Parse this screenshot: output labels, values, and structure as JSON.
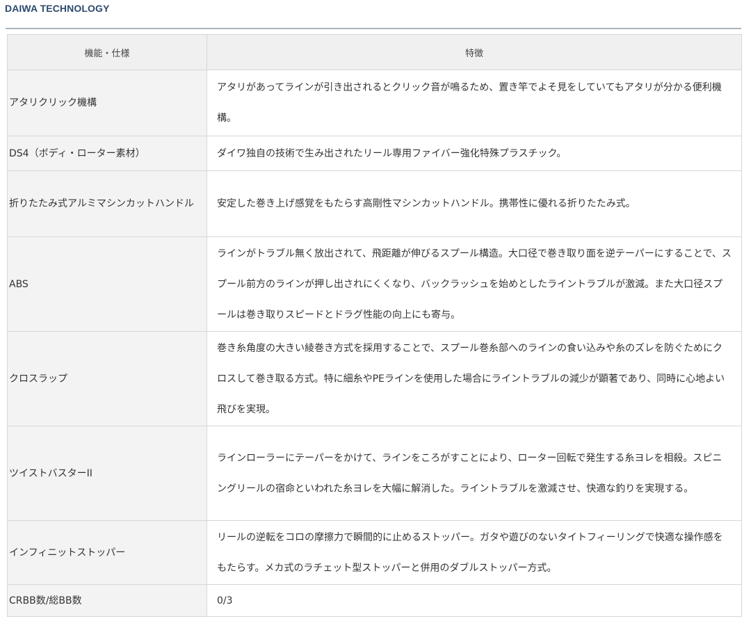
{
  "header": {
    "brand": "DAIWA TECHNOLOGY"
  },
  "table": {
    "columns": [
      "機能・仕様",
      "特徴"
    ],
    "rows": [
      {
        "name": "アタリクリック機構",
        "desc": "アタリがあってラインが引き出されるとクリック音が鳴るため、置き竿でよそ見をしていてもアタリが分かる便利機構。"
      },
      {
        "name": "DS4（ボディ・ローター素材）",
        "desc": "ダイワ独自の技術で生み出されたリール専用ファイバー強化特殊プラスチック。"
      },
      {
        "name": "折りたたみ式アルミマシンカットハンドル",
        "desc": "安定した巻き上げ感覚をもたらす高剛性マシンカットハンドル。携帯性に優れる折りたたみ式。"
      },
      {
        "name": "ABS",
        "desc": "ラインがトラブル無く放出されて、飛距離が伸びるスプール構造。大口径で巻き取り面を逆テーパーにすることで、スプール前方のラインが押し出されにくくなり、バックラッシュを始めとしたライントラブルが激減。また大口径スプールは巻き取りスピードとドラグ性能の向上にも寄与。"
      },
      {
        "name": "クロスラップ",
        "desc": "巻き糸角度の大きい綾巻き方式を採用することで、スプール巻糸部へのラインの食い込みや糸のズレを防ぐためにクロスして巻き取る方式。特に細糸やPEラインを使用した場合にライントラブルの減少が顕著であり、同時に心地よい飛びを実現。"
      },
      {
        "name": "ツイストバスターII",
        "desc": "ラインローラーにテーパーをかけて、ラインをころがすことにより、ローター回転で発生する糸ヨレを相殺。スピニングリールの宿命といわれた糸ヨレを大幅に解消した。ライントラブルを激減させ、快適な釣りを実現する。"
      },
      {
        "name": "インフィニットストッパー",
        "desc": "リールの逆転をコロの摩擦力で瞬間的に止めるストッパー。ガタや遊びのないタイトフィーリングで快適な操作感をもたらす。メカ式のラチェット型ストッパーと併用のダブルストッパー方式。"
      },
      {
        "name": "CRBB数/総BB数",
        "desc": "0/3"
      }
    ]
  }
}
